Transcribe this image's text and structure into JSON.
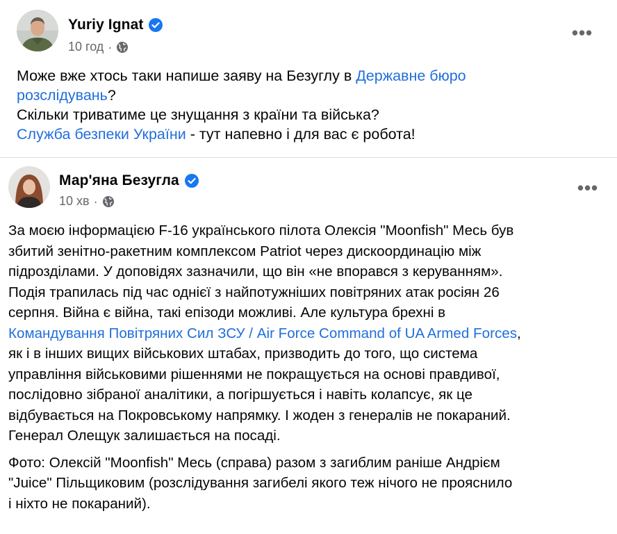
{
  "post": {
    "author": "Yuriy Ignat",
    "time": "10 год",
    "more_label": "•••",
    "text": {
      "l1_a": "Може вже хтось таки напише заяву на Безуглу в ",
      "l1_link": "Державне бюро",
      "l2_link": "розслідувань",
      "l2_b": "?",
      "l3": "Скільки триватиме це знущання з країни та війська?",
      "l4_link": "Служба безпеки України",
      "l4_b": " - тут напевно і для вас є робота!"
    }
  },
  "shared": {
    "author": "Мар'яна Безугла",
    "time": "10 хв",
    "more_label": "•••",
    "p1_lines": [
      "За моєю інформацією F-16 українського пілота Олексія \"Moonfish\" Месь був",
      "збитий зенітно-ракетним комплексом Patriot через дискоординацію між",
      "підрозділами. У доповідях зазначили, що він «не впорався з керуванням».",
      "Подія трапилась під час однієї з найпотужніших повітряних атак росіян 26",
      "серпня. Війна є війна, такі епізоди можливі. Але культура брехні в"
    ],
    "p1_link": "Командування Повітряних Сил ЗСУ / Air Force Command of UA Armed Forces",
    "p1_link_after": ",",
    "p1_lines_after": [
      "як і в інших вищих військових штабах, призводить до того, що система",
      "управління військовими рішеннями не покращується на основі правдивої,",
      "послідовно зібраної аналітики, а погіршується і навіть колапсує, як це",
      "відбувається на Покровському напрямку. І жоден з генералів не покараний.",
      "Генерал Олещук залишається на посаді."
    ],
    "p2_lines": [
      "Фото: Олексій \"Moonfish\" Месь (справа) разом з загиблим раніше Андрієм",
      "\"Juice\" Пільщиковим (розслідування загибелі якого теж нічого не прояснило",
      "і ніхто не покараний)."
    ]
  },
  "colors": {
    "link": "#216fdb",
    "verified": "#1877f2",
    "meta": "#65676b",
    "divider": "#dadde1"
  },
  "icons": {
    "verified": "verified-badge-icon",
    "audience": "globe-icon",
    "more": "more-options-icon"
  }
}
